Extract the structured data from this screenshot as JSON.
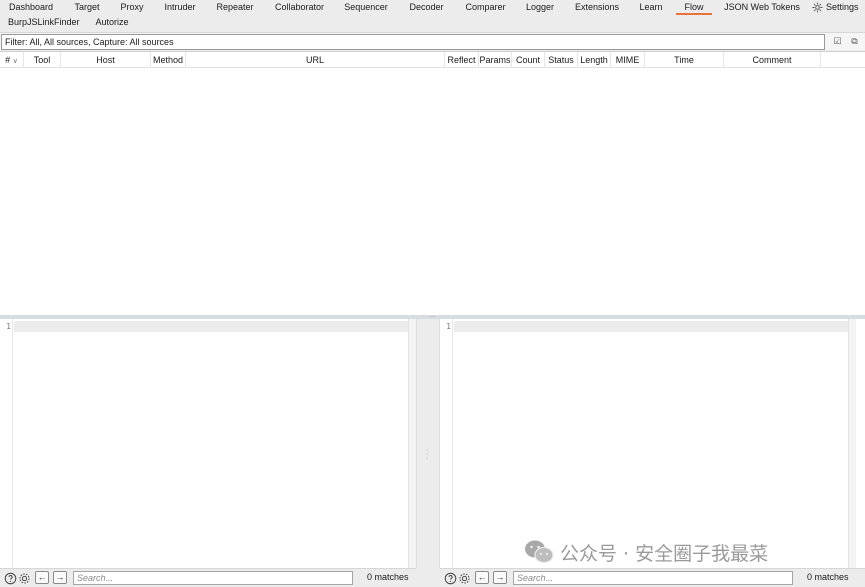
{
  "tabs": [
    {
      "label": "Dashboard"
    },
    {
      "label": "Target"
    },
    {
      "label": "Proxy"
    },
    {
      "label": "Intruder"
    },
    {
      "label": "Repeater"
    },
    {
      "label": "Collaborator"
    },
    {
      "label": "Sequencer"
    },
    {
      "label": "Decoder"
    },
    {
      "label": "Comparer"
    },
    {
      "label": "Logger"
    },
    {
      "label": "Extensions"
    },
    {
      "label": "Learn"
    },
    {
      "label": "Flow",
      "active": true
    },
    {
      "label": "JSON Web Tokens"
    },
    {
      "label": "BurpJSLinkFinder"
    },
    {
      "label": "Autorize"
    }
  ],
  "settings_label": "Settings",
  "filter": {
    "text": "Filter: All, All sources, Capture: All sources"
  },
  "table": {
    "sort_indicator": "∨",
    "columns": [
      "#",
      "Tool",
      "Host",
      "Method",
      "URL",
      "Reflect",
      "Params",
      "Count",
      "Status",
      "Length",
      "MIME",
      "Time",
      "Comment"
    ]
  },
  "request_editor": {
    "line_number": "1"
  },
  "response_editor": {
    "line_number": "1"
  },
  "bottom_left": {
    "search_placeholder": "Search...",
    "matches": "0 matches"
  },
  "bottom_right": {
    "search_placeholder": "Search...",
    "matches": "0 matches"
  },
  "watermark": {
    "text": "公众号 · 安全圈子我最菜"
  },
  "colors": {
    "active_tab_underline": "#e8743b",
    "background": "#ececec"
  }
}
